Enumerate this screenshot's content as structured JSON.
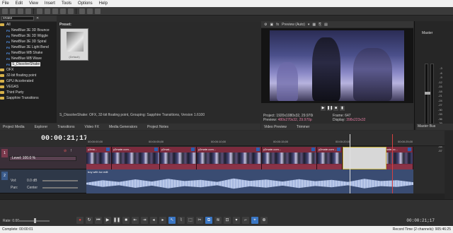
{
  "menu": [
    "File",
    "Edit",
    "View",
    "Insert",
    "Tools",
    "Options",
    "Help"
  ],
  "project_media": {
    "search_value": "shake",
    "tree": [
      {
        "label": "All",
        "kind": "folder"
      },
      {
        "label": "NewBlue 3E 3D Bounce",
        "kind": "fx"
      },
      {
        "label": "NewBlue 3E 3D Wiggle",
        "kind": "fx"
      },
      {
        "label": "NewBlue 3E 3D Spiral",
        "kind": "fx"
      },
      {
        "label": "NewBlue 3E Light Bend",
        "kind": "fx"
      },
      {
        "label": "NewBlue MB Shake",
        "kind": "fx"
      },
      {
        "label": "NewBlue MB Wave",
        "kind": "fx"
      },
      {
        "label": "S_DissolveShake",
        "kind": "fx",
        "selected": true
      },
      {
        "label": "OFX",
        "kind": "folder"
      },
      {
        "label": "32-bit floating point",
        "kind": "folder"
      },
      {
        "label": "GPU Accelerated",
        "kind": "folder"
      },
      {
        "label": "VEGAS",
        "kind": "folder"
      },
      {
        "label": "Third Party",
        "kind": "folder"
      },
      {
        "label": "Sapphire Transitions",
        "kind": "folder"
      }
    ],
    "preset_heading": "Preset:",
    "preset_thumb_label": "(Default)",
    "status": "S_DissolveShake: OFX, 32-bit floating point, Grouping: Sapphire Transitions, Version 1.6100"
  },
  "left_tabs": [
    "Project Media",
    "Explorer",
    "Transitions",
    "Video FX",
    "Media Generators",
    "Project Notes"
  ],
  "preview": {
    "quality": "Preview (Auto)",
    "project_label": "Project:",
    "project_value": "1920x1080x32, 29.970i",
    "preview_label": "Preview:",
    "preview_value": "480x270x32, 29.970p",
    "frame_label": "Frame:",
    "frame_value": "647",
    "display_label": "Display:",
    "display_value": "398x223x32",
    "tabs": [
      "Video Preview",
      "Trimmer"
    ]
  },
  "master": {
    "title": "Master",
    "scale": [
      "3",
      "6",
      "9",
      "12",
      "15",
      "18",
      "21",
      "24",
      "27",
      "30",
      "33",
      "36",
      "39",
      "42",
      "45",
      "48",
      "51",
      "54",
      "57"
    ],
    "tab": "Master Bus"
  },
  "timeline": {
    "timecode": "00:00:21;17",
    "ruler_labels": [
      "00:00:00;00",
      "00:00:05;00",
      "00:00:10;00",
      "00:00:15;00",
      "00:00:20;00",
      "00:00:25;00"
    ],
    "video_track": {
      "number": "1",
      "level_label": "Level: 100.0 %"
    },
    "audio_track": {
      "number": "2",
      "vol_label": "Vol:",
      "vol_value": "0.0 dB",
      "pan_label": "Pan:",
      "pan_value": "Center"
    },
    "video_clips": [
      "y2ma...",
      "y2mate.com...",
      "y2mat...",
      "y2mate.com...",
      "y2mate.com...",
      "y2mate.com -...",
      "y2mate.co...",
      "y2mate.co..."
    ],
    "audio_clip": "boy with luv edit"
  },
  "transport": {
    "rate_label": "Rate: 0.00",
    "end_time": "00:00:21;17"
  },
  "status": {
    "left": "Complete: 00:00:01",
    "right": "Record Time (2 channels): 905:46:25"
  },
  "colors": {
    "video_clip": "#7c2b3d",
    "audio_clip": "#3a4c72",
    "selection_accent": "#3a76c4"
  }
}
